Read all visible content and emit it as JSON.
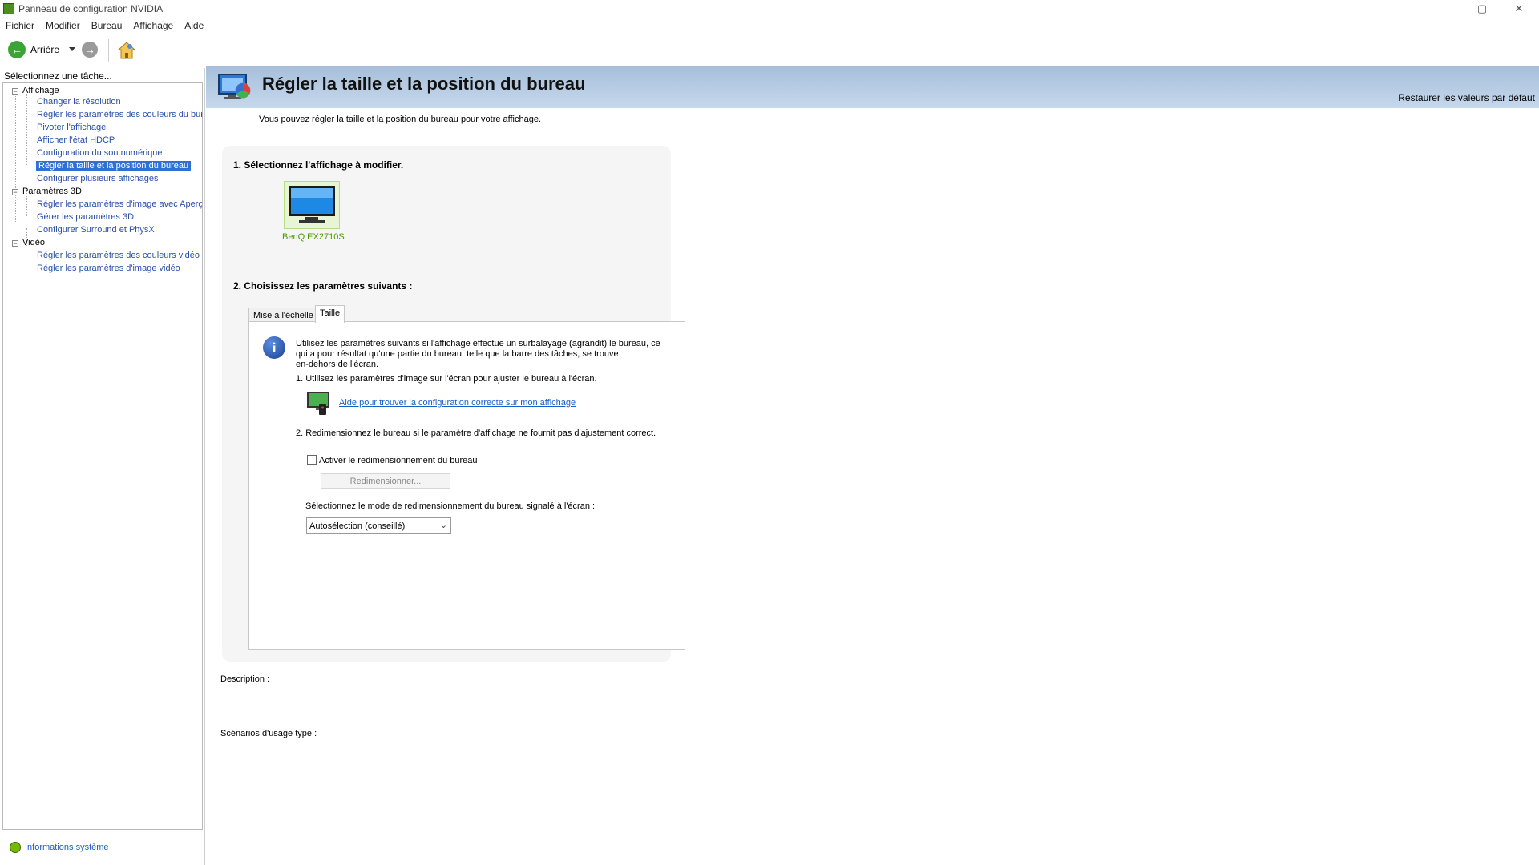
{
  "window": {
    "title": "Panneau de configuration NVIDIA",
    "minimize": "–",
    "maximize": "▢",
    "close": "✕"
  },
  "menu": {
    "items": [
      "Fichier",
      "Modifier",
      "Bureau",
      "Affichage",
      "Aide"
    ]
  },
  "toolbar": {
    "back_label": "Arrière"
  },
  "sidebar": {
    "task_label": "Sélectionnez une tâche...",
    "categories": [
      {
        "label": "Affichage",
        "items": [
          "Changer la résolution",
          "Régler les paramètres des couleurs du bureau",
          "Pivoter l'affichage",
          "Afficher l'état HDCP",
          "Configuration du son numérique",
          "Régler la taille et la position du bureau",
          "Configurer plusieurs affichages"
        ]
      },
      {
        "label": "Paramètres 3D",
        "items": [
          "Régler les paramètres d'image avec Aperçu",
          "Gérer les paramètres 3D",
          "Configurer Surround et PhysX"
        ]
      },
      {
        "label": "Vidéo",
        "items": [
          "Régler les paramètres des couleurs vidéo",
          "Régler les paramètres d'image vidéo"
        ]
      }
    ],
    "selected_item": "Régler la taille et la position du bureau",
    "system_info_link": "Informations système"
  },
  "main": {
    "title": "Régler la taille et la position du bureau",
    "restore_defaults": "Restaurer les valeurs par défaut",
    "subtitle": "Vous pouvez régler la taille et la position du bureau pour votre affichage.",
    "step1_title": "1. Sélectionnez l'affichage à modifier.",
    "display_name": "BenQ EX2710S",
    "step2_title": "2. Choisissez les paramètres suivants :",
    "tabs": [
      {
        "label": "Mise à l'échelle",
        "active": false
      },
      {
        "label": "Taille",
        "active": true
      }
    ],
    "info_text_line1": "Utilisez les paramètres suivants si l'affichage effectue un surbalayage (agrandit) le bureau, ce",
    "info_text_line2": "qui a pour résultat qu'une partie du bureau, telle que la barre des tâches, se trouve",
    "info_text_line3": "en-dehors de l'écran.",
    "step_a": "1. Utilisez les paramètres d'image sur l'écran pour ajuster le bureau à l'écran.",
    "help_link": "Aide pour trouver la configuration correcte sur mon affichage",
    "step_b": "2. Redimensionnez le bureau si le paramètre d'affichage ne fournit pas d'ajustement correct.",
    "enable_resize_label": "Activer le redimensionnement du bureau",
    "enable_resize_checked": false,
    "resize_button": "Redimensionner...",
    "mode_label": "Sélectionnez le mode de redimensionnement du bureau signalé à l'écran :",
    "mode_selected": "Autosélection (conseillé)",
    "description_label": "Description :",
    "usage_label": "Scénarios d'usage type :"
  },
  "colors": {
    "nvidia_green": "#76b900",
    "link_blue": "#1a5ec8",
    "selection_blue": "#2f6fd6",
    "header_blue": "#a6bfda"
  }
}
